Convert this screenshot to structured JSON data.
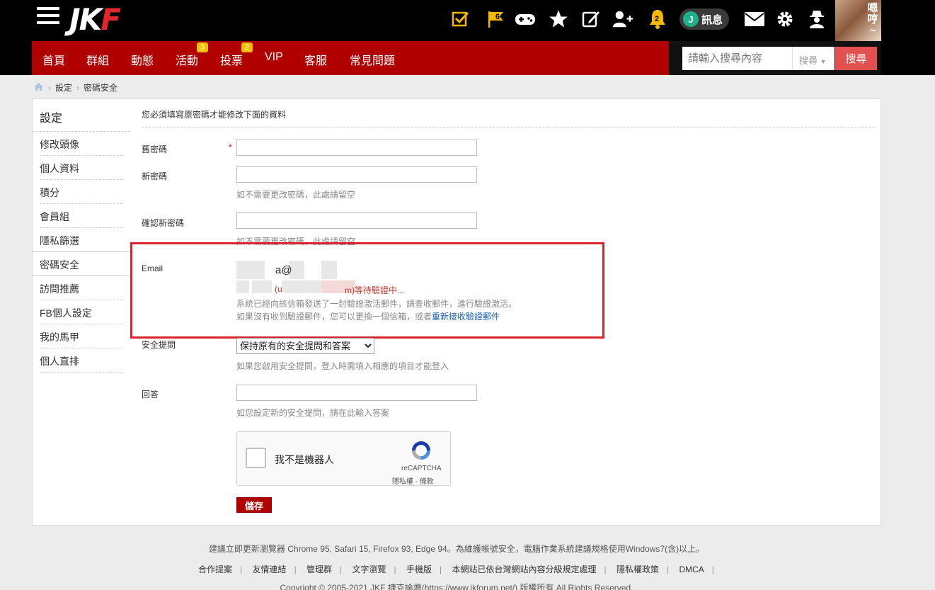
{
  "header": {
    "logo_main": "JK",
    "logo_f": "F",
    "flag_badge": "6",
    "bell_badge": "2",
    "messages_j": "J",
    "messages_label": "訊息",
    "avatar_text": "嗯哼~"
  },
  "nav": {
    "items": [
      {
        "label": "首頁"
      },
      {
        "label": "群組"
      },
      {
        "label": "動態"
      },
      {
        "label": "活動",
        "badge": "3"
      },
      {
        "label": "投票",
        "badge": "2"
      },
      {
        "label": "VIP"
      },
      {
        "label": "客服"
      },
      {
        "label": "常見問題"
      }
    ],
    "search_placeholder": "請輸入搜尋內容",
    "search_type": "搜尋",
    "search_button": "搜尋"
  },
  "breadcrumb": {
    "items": [
      "設定",
      "密碼安全"
    ]
  },
  "sidebar": {
    "title": "設定",
    "items": [
      {
        "label": "修改頭像"
      },
      {
        "label": "個人資料"
      },
      {
        "label": "積分"
      },
      {
        "label": "會員組"
      },
      {
        "label": "隱私篩選"
      },
      {
        "label": "密碼安全"
      },
      {
        "label": "訪問推薦"
      },
      {
        "label": "FB個人設定"
      },
      {
        "label": "我的馬甲"
      },
      {
        "label": "個人直排"
      }
    ]
  },
  "form": {
    "notice": "您必須填寫原密碼才能修改下面的資料",
    "old_password_label": "舊密碼",
    "required_mark": "*",
    "new_password_label": "新密碼",
    "new_password_hint": "如不需要更改密碼，此處請留空",
    "confirm_label": "確認新密碼",
    "confirm_hint": "如不需要更改密碼，此處請留空",
    "email_label": "Email",
    "email_value": "a@",
    "email_verify_user": "(u",
    "email_verify_tail": "m)等待驗證中...",
    "email_sent": "系統已經向該信箱發送了一封驗證激活郵件，請查收郵件，進行驗證激活。",
    "email_resend_prefix": "如果沒有收到驗證郵件，您可以更換一個信箱，或者",
    "email_resend_link": "重新接收驗證郵件",
    "security_label": "安全提問",
    "security_option": "保持原有的安全提問和答案",
    "security_hint": "如果您啟用安全提問，登入時需填入相應的項目才能登入",
    "answer_label": "回答",
    "answer_hint": "如您設定新的安全提問，請在此輸入答案",
    "captcha_label": "我不是機器人",
    "captcha_brand": "reCAPTCHA",
    "captcha_terms": "隱私權 - 條款",
    "save_button": "儲存"
  },
  "footer": {
    "browser_note": "建議立即更新瀏覽器 Chrome 95, Safari 15, Firefox 93, Edge 94。為維護帳號安全，電腦作業系統建議規格使用Windows7(含)以上。",
    "links": [
      "合作提案",
      "友情連結",
      "管理群",
      "文字瀏覽",
      "手機版",
      "本網站已依台灣網站內容分級規定處理",
      "隱私權政策",
      "DMCA"
    ],
    "copyright": "Copyright © 2005-2021 JKF 捷克論壇(https://www.jkforum.net/) 版權所有 All Rights Reserved."
  }
}
